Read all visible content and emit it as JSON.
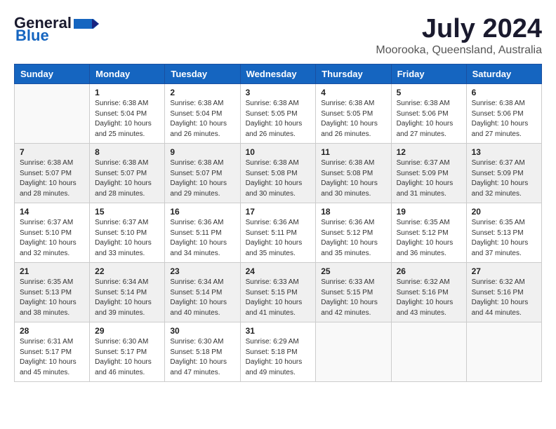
{
  "header": {
    "logo_general": "General",
    "logo_blue": "Blue",
    "month_year": "July 2024",
    "location": "Moorooka, Queensland, Australia"
  },
  "days_of_week": [
    "Sunday",
    "Monday",
    "Tuesday",
    "Wednesday",
    "Thursday",
    "Friday",
    "Saturday"
  ],
  "weeks": [
    [
      {
        "day": "",
        "sunrise": "",
        "sunset": "",
        "daylight": ""
      },
      {
        "day": "1",
        "sunrise": "Sunrise: 6:38 AM",
        "sunset": "Sunset: 5:04 PM",
        "daylight": "Daylight: 10 hours and 25 minutes."
      },
      {
        "day": "2",
        "sunrise": "Sunrise: 6:38 AM",
        "sunset": "Sunset: 5:04 PM",
        "daylight": "Daylight: 10 hours and 26 minutes."
      },
      {
        "day": "3",
        "sunrise": "Sunrise: 6:38 AM",
        "sunset": "Sunset: 5:05 PM",
        "daylight": "Daylight: 10 hours and 26 minutes."
      },
      {
        "day": "4",
        "sunrise": "Sunrise: 6:38 AM",
        "sunset": "Sunset: 5:05 PM",
        "daylight": "Daylight: 10 hours and 26 minutes."
      },
      {
        "day": "5",
        "sunrise": "Sunrise: 6:38 AM",
        "sunset": "Sunset: 5:06 PM",
        "daylight": "Daylight: 10 hours and 27 minutes."
      },
      {
        "day": "6",
        "sunrise": "Sunrise: 6:38 AM",
        "sunset": "Sunset: 5:06 PM",
        "daylight": "Daylight: 10 hours and 27 minutes."
      }
    ],
    [
      {
        "day": "7",
        "sunrise": "Sunrise: 6:38 AM",
        "sunset": "Sunset: 5:07 PM",
        "daylight": "Daylight: 10 hours and 28 minutes."
      },
      {
        "day": "8",
        "sunrise": "Sunrise: 6:38 AM",
        "sunset": "Sunset: 5:07 PM",
        "daylight": "Daylight: 10 hours and 28 minutes."
      },
      {
        "day": "9",
        "sunrise": "Sunrise: 6:38 AM",
        "sunset": "Sunset: 5:07 PM",
        "daylight": "Daylight: 10 hours and 29 minutes."
      },
      {
        "day": "10",
        "sunrise": "Sunrise: 6:38 AM",
        "sunset": "Sunset: 5:08 PM",
        "daylight": "Daylight: 10 hours and 30 minutes."
      },
      {
        "day": "11",
        "sunrise": "Sunrise: 6:38 AM",
        "sunset": "Sunset: 5:08 PM",
        "daylight": "Daylight: 10 hours and 30 minutes."
      },
      {
        "day": "12",
        "sunrise": "Sunrise: 6:37 AM",
        "sunset": "Sunset: 5:09 PM",
        "daylight": "Daylight: 10 hours and 31 minutes."
      },
      {
        "day": "13",
        "sunrise": "Sunrise: 6:37 AM",
        "sunset": "Sunset: 5:09 PM",
        "daylight": "Daylight: 10 hours and 32 minutes."
      }
    ],
    [
      {
        "day": "14",
        "sunrise": "Sunrise: 6:37 AM",
        "sunset": "Sunset: 5:10 PM",
        "daylight": "Daylight: 10 hours and 32 minutes."
      },
      {
        "day": "15",
        "sunrise": "Sunrise: 6:37 AM",
        "sunset": "Sunset: 5:10 PM",
        "daylight": "Daylight: 10 hours and 33 minutes."
      },
      {
        "day": "16",
        "sunrise": "Sunrise: 6:36 AM",
        "sunset": "Sunset: 5:11 PM",
        "daylight": "Daylight: 10 hours and 34 minutes."
      },
      {
        "day": "17",
        "sunrise": "Sunrise: 6:36 AM",
        "sunset": "Sunset: 5:11 PM",
        "daylight": "Daylight: 10 hours and 35 minutes."
      },
      {
        "day": "18",
        "sunrise": "Sunrise: 6:36 AM",
        "sunset": "Sunset: 5:12 PM",
        "daylight": "Daylight: 10 hours and 35 minutes."
      },
      {
        "day": "19",
        "sunrise": "Sunrise: 6:35 AM",
        "sunset": "Sunset: 5:12 PM",
        "daylight": "Daylight: 10 hours and 36 minutes."
      },
      {
        "day": "20",
        "sunrise": "Sunrise: 6:35 AM",
        "sunset": "Sunset: 5:13 PM",
        "daylight": "Daylight: 10 hours and 37 minutes."
      }
    ],
    [
      {
        "day": "21",
        "sunrise": "Sunrise: 6:35 AM",
        "sunset": "Sunset: 5:13 PM",
        "daylight": "Daylight: 10 hours and 38 minutes."
      },
      {
        "day": "22",
        "sunrise": "Sunrise: 6:34 AM",
        "sunset": "Sunset: 5:14 PM",
        "daylight": "Daylight: 10 hours and 39 minutes."
      },
      {
        "day": "23",
        "sunrise": "Sunrise: 6:34 AM",
        "sunset": "Sunset: 5:14 PM",
        "daylight": "Daylight: 10 hours and 40 minutes."
      },
      {
        "day": "24",
        "sunrise": "Sunrise: 6:33 AM",
        "sunset": "Sunset: 5:15 PM",
        "daylight": "Daylight: 10 hours and 41 minutes."
      },
      {
        "day": "25",
        "sunrise": "Sunrise: 6:33 AM",
        "sunset": "Sunset: 5:15 PM",
        "daylight": "Daylight: 10 hours and 42 minutes."
      },
      {
        "day": "26",
        "sunrise": "Sunrise: 6:32 AM",
        "sunset": "Sunset: 5:16 PM",
        "daylight": "Daylight: 10 hours and 43 minutes."
      },
      {
        "day": "27",
        "sunrise": "Sunrise: 6:32 AM",
        "sunset": "Sunset: 5:16 PM",
        "daylight": "Daylight: 10 hours and 44 minutes."
      }
    ],
    [
      {
        "day": "28",
        "sunrise": "Sunrise: 6:31 AM",
        "sunset": "Sunset: 5:17 PM",
        "daylight": "Daylight: 10 hours and 45 minutes."
      },
      {
        "day": "29",
        "sunrise": "Sunrise: 6:30 AM",
        "sunset": "Sunset: 5:17 PM",
        "daylight": "Daylight: 10 hours and 46 minutes."
      },
      {
        "day": "30",
        "sunrise": "Sunrise: 6:30 AM",
        "sunset": "Sunset: 5:18 PM",
        "daylight": "Daylight: 10 hours and 47 minutes."
      },
      {
        "day": "31",
        "sunrise": "Sunrise: 6:29 AM",
        "sunset": "Sunset: 5:18 PM",
        "daylight": "Daylight: 10 hours and 49 minutes."
      },
      {
        "day": "",
        "sunrise": "",
        "sunset": "",
        "daylight": ""
      },
      {
        "day": "",
        "sunrise": "",
        "sunset": "",
        "daylight": ""
      },
      {
        "day": "",
        "sunrise": "",
        "sunset": "",
        "daylight": ""
      }
    ]
  ]
}
